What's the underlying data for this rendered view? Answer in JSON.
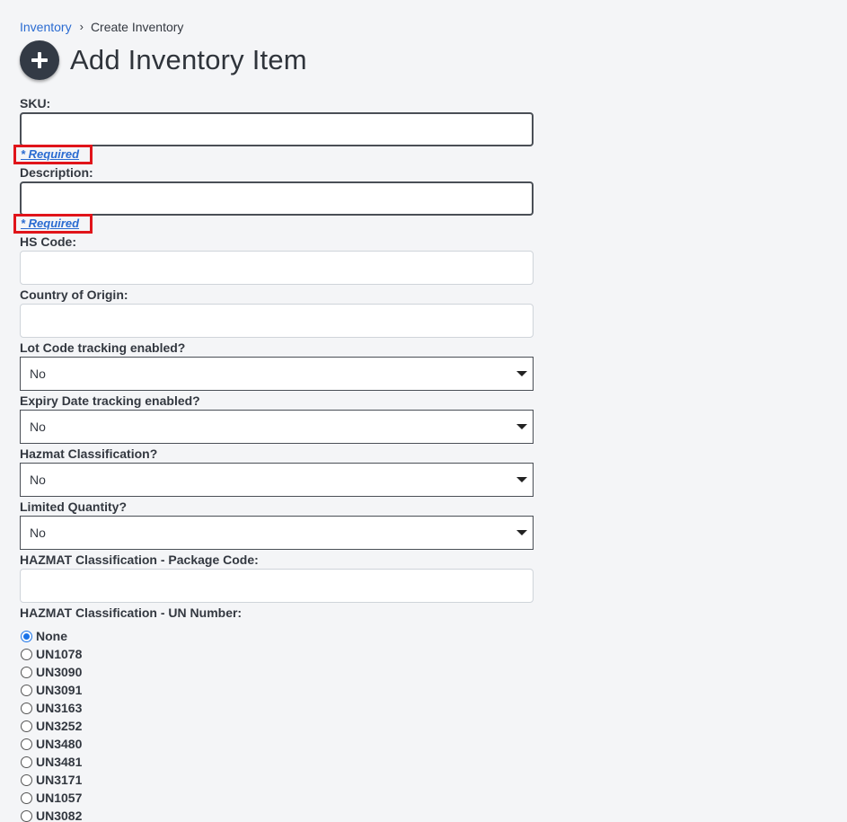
{
  "breadcrumb": {
    "parent": "Inventory",
    "separator": "›",
    "current": "Create Inventory"
  },
  "header": {
    "title": "Add Inventory Item",
    "icon": "plus-circle-icon"
  },
  "form": {
    "sku": {
      "label": "SKU:",
      "value": "",
      "required_note": "* Required"
    },
    "description": {
      "label": "Description:",
      "value": "",
      "required_note": "* Required"
    },
    "hs_code": {
      "label": "HS Code:",
      "value": ""
    },
    "country_of_origin": {
      "label": "Country of Origin:",
      "value": ""
    },
    "lot_code": {
      "label": "Lot Code tracking enabled?",
      "value": "No"
    },
    "expiry_date": {
      "label": "Expiry Date tracking enabled?",
      "value": "No"
    },
    "hazmat_classification": {
      "label": "Hazmat Classification?",
      "value": "No"
    },
    "limited_quantity": {
      "label": "Limited Quantity?",
      "value": "No"
    },
    "package_code": {
      "label": "HAZMAT Classification - Package Code:",
      "value": ""
    },
    "un_number": {
      "label": "HAZMAT Classification - UN Number:",
      "selected": "None",
      "options": [
        "None",
        "UN1078",
        "UN3090",
        "UN3091",
        "UN3163",
        "UN3252",
        "UN3480",
        "UN3481",
        "UN3171",
        "UN1057",
        "UN3082"
      ]
    }
  },
  "colors": {
    "link": "#2a6bd1",
    "required_highlight": "#e0141a",
    "background": "#f4f5f7"
  }
}
